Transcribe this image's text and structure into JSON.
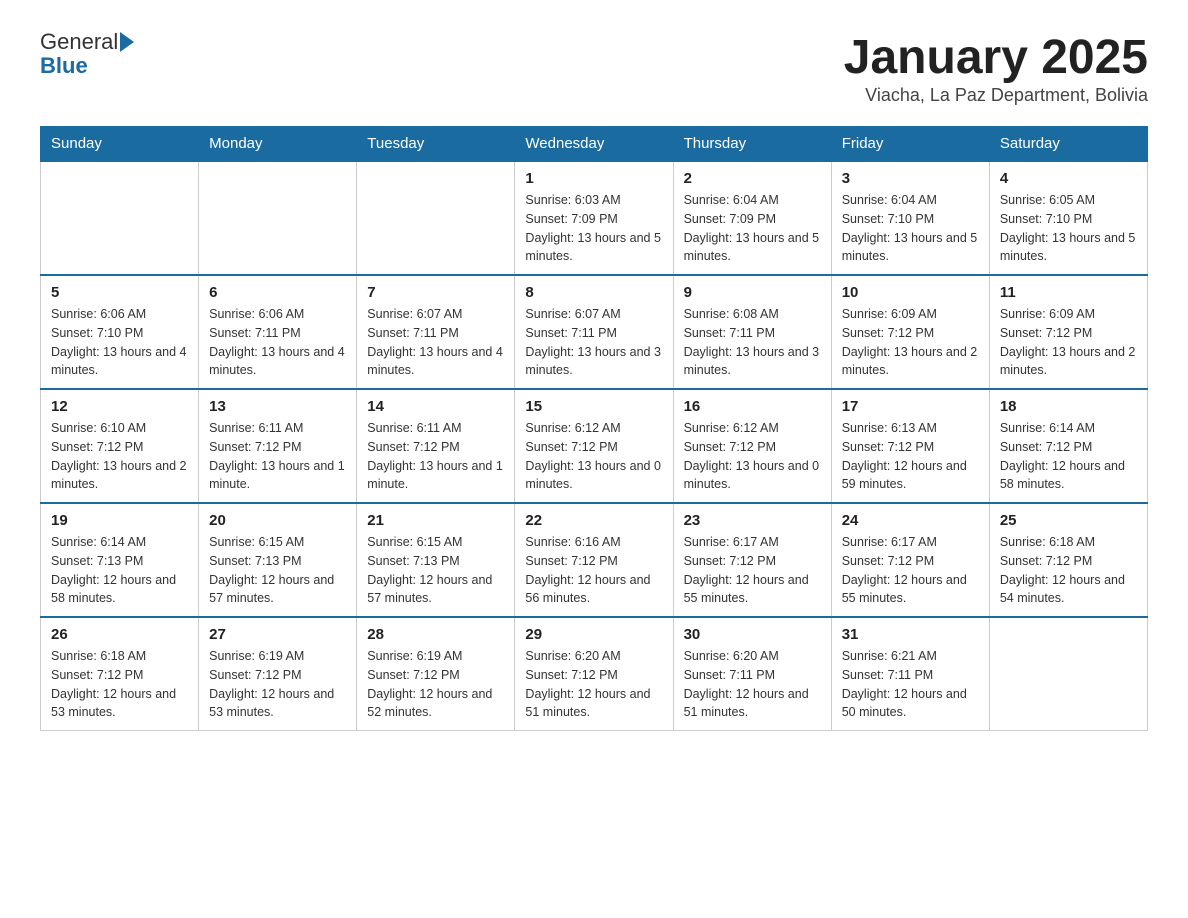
{
  "logo": {
    "text_general": "General",
    "text_blue": "Blue"
  },
  "header": {
    "title": "January 2025",
    "subtitle": "Viacha, La Paz Department, Bolivia"
  },
  "weekdays": [
    "Sunday",
    "Monday",
    "Tuesday",
    "Wednesday",
    "Thursday",
    "Friday",
    "Saturday"
  ],
  "weeks": [
    [
      {
        "day": "",
        "sunrise": "",
        "sunset": "",
        "daylight": ""
      },
      {
        "day": "",
        "sunrise": "",
        "sunset": "",
        "daylight": ""
      },
      {
        "day": "",
        "sunrise": "",
        "sunset": "",
        "daylight": ""
      },
      {
        "day": "1",
        "sunrise": "Sunrise: 6:03 AM",
        "sunset": "Sunset: 7:09 PM",
        "daylight": "Daylight: 13 hours and 5 minutes."
      },
      {
        "day": "2",
        "sunrise": "Sunrise: 6:04 AM",
        "sunset": "Sunset: 7:09 PM",
        "daylight": "Daylight: 13 hours and 5 minutes."
      },
      {
        "day": "3",
        "sunrise": "Sunrise: 6:04 AM",
        "sunset": "Sunset: 7:10 PM",
        "daylight": "Daylight: 13 hours and 5 minutes."
      },
      {
        "day": "4",
        "sunrise": "Sunrise: 6:05 AM",
        "sunset": "Sunset: 7:10 PM",
        "daylight": "Daylight: 13 hours and 5 minutes."
      }
    ],
    [
      {
        "day": "5",
        "sunrise": "Sunrise: 6:06 AM",
        "sunset": "Sunset: 7:10 PM",
        "daylight": "Daylight: 13 hours and 4 minutes."
      },
      {
        "day": "6",
        "sunrise": "Sunrise: 6:06 AM",
        "sunset": "Sunset: 7:11 PM",
        "daylight": "Daylight: 13 hours and 4 minutes."
      },
      {
        "day": "7",
        "sunrise": "Sunrise: 6:07 AM",
        "sunset": "Sunset: 7:11 PM",
        "daylight": "Daylight: 13 hours and 4 minutes."
      },
      {
        "day": "8",
        "sunrise": "Sunrise: 6:07 AM",
        "sunset": "Sunset: 7:11 PM",
        "daylight": "Daylight: 13 hours and 3 minutes."
      },
      {
        "day": "9",
        "sunrise": "Sunrise: 6:08 AM",
        "sunset": "Sunset: 7:11 PM",
        "daylight": "Daylight: 13 hours and 3 minutes."
      },
      {
        "day": "10",
        "sunrise": "Sunrise: 6:09 AM",
        "sunset": "Sunset: 7:12 PM",
        "daylight": "Daylight: 13 hours and 2 minutes."
      },
      {
        "day": "11",
        "sunrise": "Sunrise: 6:09 AM",
        "sunset": "Sunset: 7:12 PM",
        "daylight": "Daylight: 13 hours and 2 minutes."
      }
    ],
    [
      {
        "day": "12",
        "sunrise": "Sunrise: 6:10 AM",
        "sunset": "Sunset: 7:12 PM",
        "daylight": "Daylight: 13 hours and 2 minutes."
      },
      {
        "day": "13",
        "sunrise": "Sunrise: 6:11 AM",
        "sunset": "Sunset: 7:12 PM",
        "daylight": "Daylight: 13 hours and 1 minute."
      },
      {
        "day": "14",
        "sunrise": "Sunrise: 6:11 AM",
        "sunset": "Sunset: 7:12 PM",
        "daylight": "Daylight: 13 hours and 1 minute."
      },
      {
        "day": "15",
        "sunrise": "Sunrise: 6:12 AM",
        "sunset": "Sunset: 7:12 PM",
        "daylight": "Daylight: 13 hours and 0 minutes."
      },
      {
        "day": "16",
        "sunrise": "Sunrise: 6:12 AM",
        "sunset": "Sunset: 7:12 PM",
        "daylight": "Daylight: 13 hours and 0 minutes."
      },
      {
        "day": "17",
        "sunrise": "Sunrise: 6:13 AM",
        "sunset": "Sunset: 7:12 PM",
        "daylight": "Daylight: 12 hours and 59 minutes."
      },
      {
        "day": "18",
        "sunrise": "Sunrise: 6:14 AM",
        "sunset": "Sunset: 7:12 PM",
        "daylight": "Daylight: 12 hours and 58 minutes."
      }
    ],
    [
      {
        "day": "19",
        "sunrise": "Sunrise: 6:14 AM",
        "sunset": "Sunset: 7:13 PM",
        "daylight": "Daylight: 12 hours and 58 minutes."
      },
      {
        "day": "20",
        "sunrise": "Sunrise: 6:15 AM",
        "sunset": "Sunset: 7:13 PM",
        "daylight": "Daylight: 12 hours and 57 minutes."
      },
      {
        "day": "21",
        "sunrise": "Sunrise: 6:15 AM",
        "sunset": "Sunset: 7:13 PM",
        "daylight": "Daylight: 12 hours and 57 minutes."
      },
      {
        "day": "22",
        "sunrise": "Sunrise: 6:16 AM",
        "sunset": "Sunset: 7:12 PM",
        "daylight": "Daylight: 12 hours and 56 minutes."
      },
      {
        "day": "23",
        "sunrise": "Sunrise: 6:17 AM",
        "sunset": "Sunset: 7:12 PM",
        "daylight": "Daylight: 12 hours and 55 minutes."
      },
      {
        "day": "24",
        "sunrise": "Sunrise: 6:17 AM",
        "sunset": "Sunset: 7:12 PM",
        "daylight": "Daylight: 12 hours and 55 minutes."
      },
      {
        "day": "25",
        "sunrise": "Sunrise: 6:18 AM",
        "sunset": "Sunset: 7:12 PM",
        "daylight": "Daylight: 12 hours and 54 minutes."
      }
    ],
    [
      {
        "day": "26",
        "sunrise": "Sunrise: 6:18 AM",
        "sunset": "Sunset: 7:12 PM",
        "daylight": "Daylight: 12 hours and 53 minutes."
      },
      {
        "day": "27",
        "sunrise": "Sunrise: 6:19 AM",
        "sunset": "Sunset: 7:12 PM",
        "daylight": "Daylight: 12 hours and 53 minutes."
      },
      {
        "day": "28",
        "sunrise": "Sunrise: 6:19 AM",
        "sunset": "Sunset: 7:12 PM",
        "daylight": "Daylight: 12 hours and 52 minutes."
      },
      {
        "day": "29",
        "sunrise": "Sunrise: 6:20 AM",
        "sunset": "Sunset: 7:12 PM",
        "daylight": "Daylight: 12 hours and 51 minutes."
      },
      {
        "day": "30",
        "sunrise": "Sunrise: 6:20 AM",
        "sunset": "Sunset: 7:11 PM",
        "daylight": "Daylight: 12 hours and 51 minutes."
      },
      {
        "day": "31",
        "sunrise": "Sunrise: 6:21 AM",
        "sunset": "Sunset: 7:11 PM",
        "daylight": "Daylight: 12 hours and 50 minutes."
      },
      {
        "day": "",
        "sunrise": "",
        "sunset": "",
        "daylight": ""
      }
    ]
  ]
}
